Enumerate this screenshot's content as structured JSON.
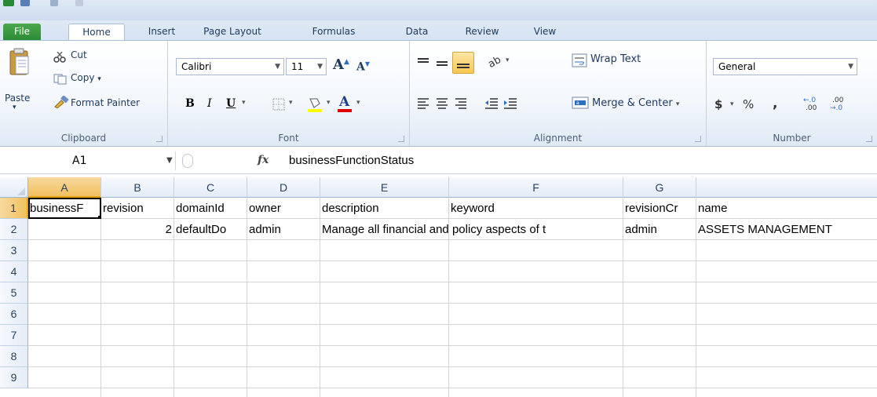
{
  "tabs": {
    "file": "File",
    "home": "Home",
    "insert": "Insert",
    "page_layout": "Page Layout",
    "formulas": "Formulas",
    "data": "Data",
    "review": "Review",
    "view": "View"
  },
  "clipboard": {
    "paste": "Paste",
    "cut": "Cut",
    "copy": "Copy",
    "format_painter": "Format Painter",
    "label": "Clipboard"
  },
  "font": {
    "name": "Calibri",
    "size": "11",
    "label": "Font",
    "bold": "B",
    "italic": "I",
    "underline": "U",
    "font_color_glyph": "A",
    "grow": "A",
    "shrink": "A"
  },
  "alignment": {
    "wrap_text": "Wrap Text",
    "merge_center": "Merge & Center",
    "label": "Alignment"
  },
  "number": {
    "format": "General",
    "currency": "$",
    "percent": "%",
    "comma": ",",
    "label": "Number"
  },
  "formula_bar": {
    "name_box": "A1",
    "fx": "fx",
    "content": "businessFunctionStatus"
  },
  "columns": [
    "A",
    "B",
    "C",
    "D",
    "E",
    "F",
    "G"
  ],
  "rows": [
    "1",
    "2",
    "3",
    "4",
    "5",
    "6",
    "7",
    "8",
    "9"
  ],
  "cells": {
    "row1": {
      "A": "businessF",
      "B": "revision",
      "C": "domainId",
      "D": "owner",
      "E": "description",
      "F": "keyword",
      "G": "revisionCr",
      "H": "name"
    },
    "row2": {
      "B": "2",
      "C": "defaultDo",
      "D": "admin",
      "E": "Manage all financial and policy aspects of t",
      "G": "admin",
      "H": "ASSETS MANAGEMENT"
    }
  },
  "colors": {
    "file_tab": "#2a8a34",
    "selection_header": "#f1c15f",
    "ribbon_border": "#a9bfd6",
    "gridline": "#d4d4d4"
  }
}
